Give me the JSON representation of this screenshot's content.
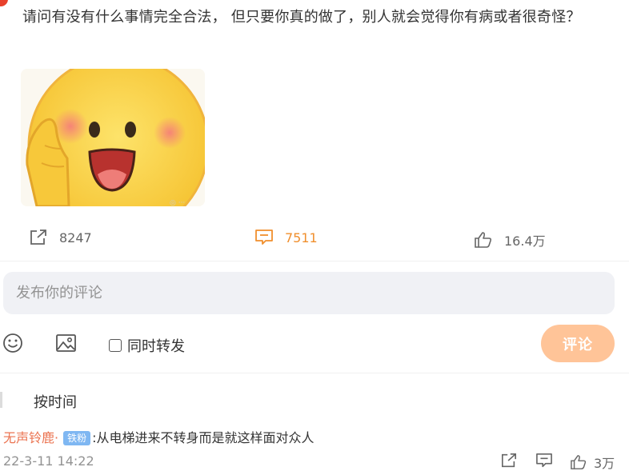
{
  "post": {
    "text": "请问有没有什么事情完全合法， 但只要你真的做了，别人就会觉得你有病或者很奇怪？",
    "image": {
      "description": "smiling-emoji-sticker"
    },
    "actions": {
      "reposts": "8247",
      "comments": "7511",
      "likes": "16.4万"
    }
  },
  "composer": {
    "placeholder": "发布你的评论",
    "repost_label": "同时转发",
    "submit_label": "评论"
  },
  "sort": {
    "label": "按时间"
  },
  "comments": [
    {
      "user": "无声铃鹿",
      "badge": "铁粉",
      "text": ":从电梯进来不转身而是就这样面对众人",
      "time": "22-3-11 14:22",
      "likes": "3万"
    }
  ],
  "colors": {
    "accent_orange": "#f08f2d",
    "username": "#eb7350",
    "submit_disabled": "#ffc498",
    "fan_badge": "#7fb7f2"
  }
}
